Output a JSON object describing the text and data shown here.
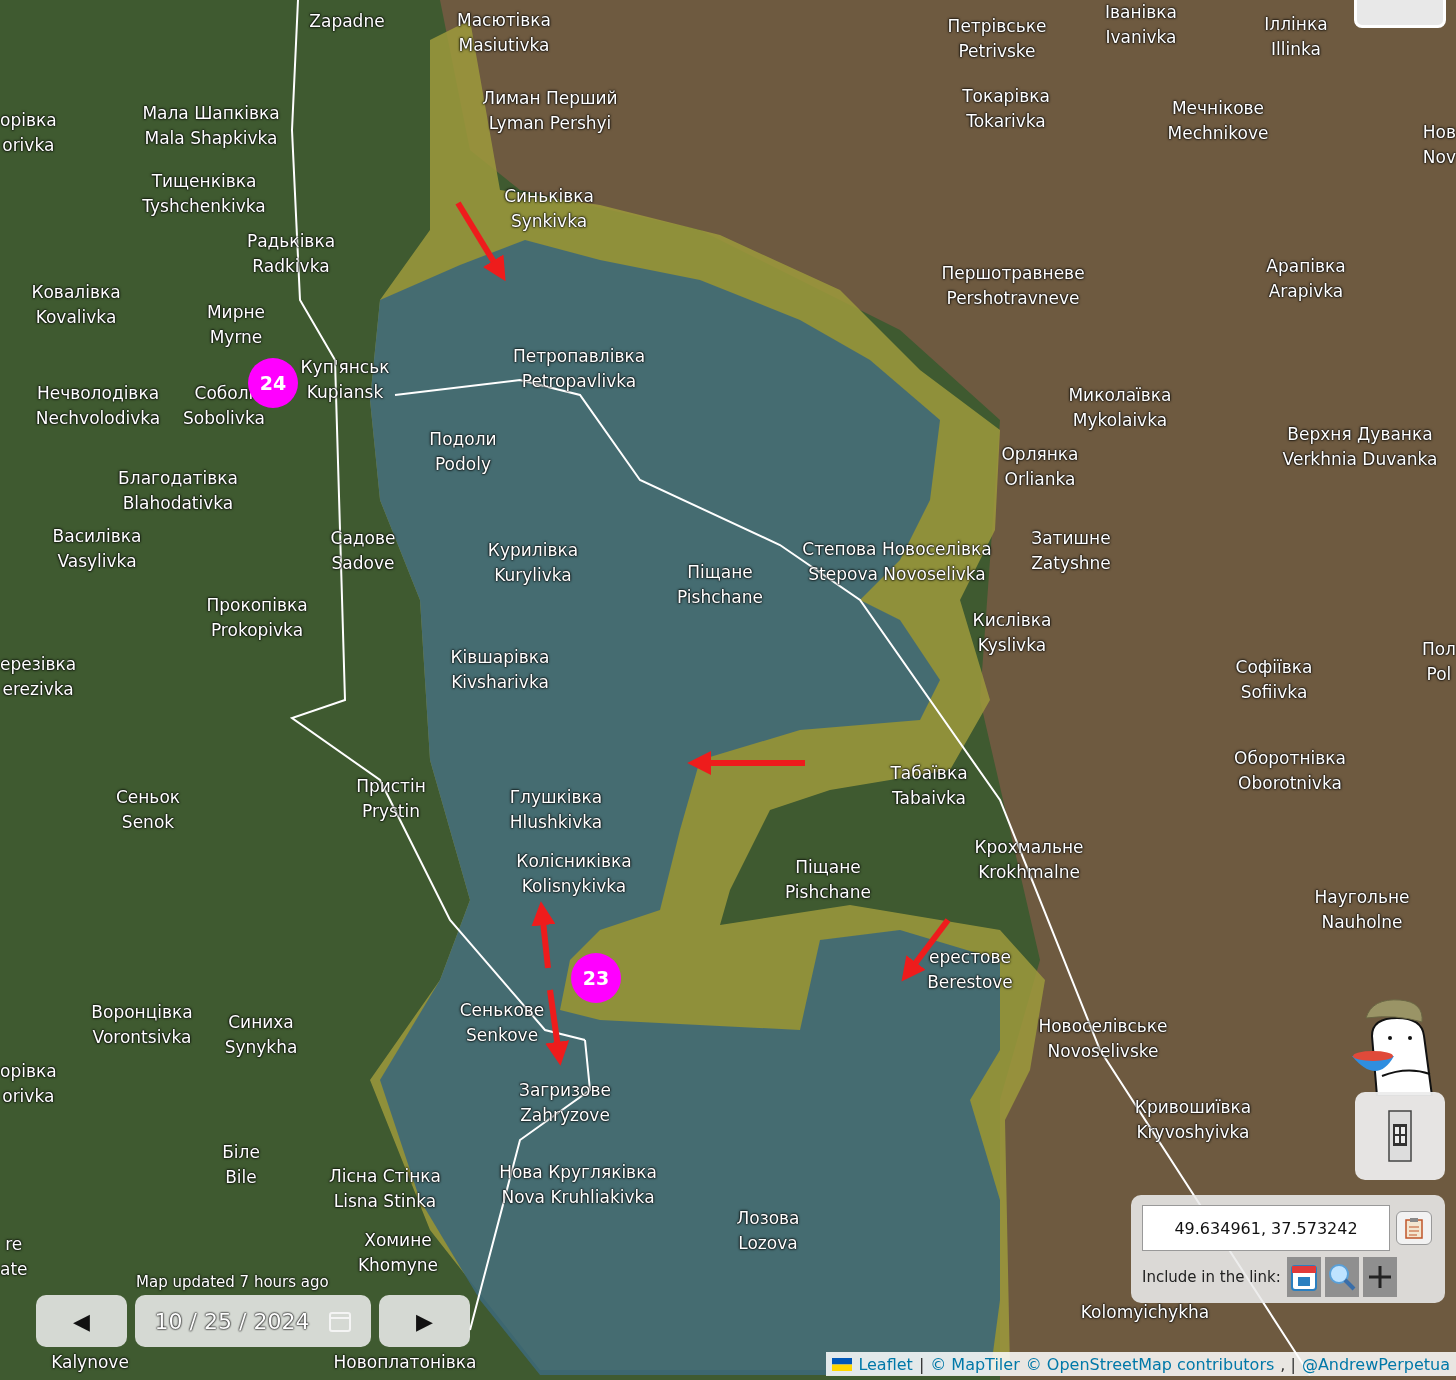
{
  "map": {
    "places": [
      {
        "lines": [
          "Zapadne"
        ]
      },
      {
        "lines": [
          "Масютівка",
          "Masiutivka"
        ]
      },
      {
        "lines": [
          "Лиман Перший",
          "Lyman Pershyi"
        ]
      },
      {
        "lines": [
          "Синьківка",
          "Synkivka"
        ]
      },
      {
        "lines": [
          "Петрівське",
          "Petrivske"
        ]
      },
      {
        "lines": [
          "Іванівка",
          "Ivanivka"
        ]
      },
      {
        "lines": [
          "Іллінка",
          "Illinka"
        ]
      },
      {
        "lines": [
          "Токарівка",
          "Tokarivka"
        ]
      },
      {
        "lines": [
          "Мечнікове",
          "Mechnikove"
        ]
      },
      {
        "lines": [
          "Нов",
          "Nov"
        ]
      },
      {
        "lines": [
          "орівка",
          "orivka"
        ]
      },
      {
        "lines": [
          "Мала Шапківка",
          "Mala Shapkivka"
        ]
      },
      {
        "lines": [
          "Тищенківка",
          "Tyshchenkivka"
        ]
      },
      {
        "lines": [
          "Радьківка",
          "Radkivka"
        ]
      },
      {
        "lines": [
          "Ковалівка",
          "Kovalivka"
        ]
      },
      {
        "lines": [
          "Мирне",
          "Myrne"
        ]
      },
      {
        "lines": [
          "Першотравневе",
          "Pershotravneve"
        ]
      },
      {
        "lines": [
          "Арапівка",
          "Arapivka"
        ]
      },
      {
        "lines": [
          "Куп'янськ",
          "Kupiansk"
        ]
      },
      {
        "lines": [
          "Нечволодівка",
          "Nechvolodivka"
        ]
      },
      {
        "lines": [
          "Соболі",
          "Sobolivka"
        ]
      },
      {
        "lines": [
          "Петропавлівка",
          "Petropavlivka"
        ]
      },
      {
        "lines": [
          "Миколаївка",
          "Mykolaivka"
        ]
      },
      {
        "lines": [
          "Подоли",
          "Podoly"
        ]
      },
      {
        "lines": [
          "Верхня Дуванка",
          "Verkhnia Duvanka"
        ]
      },
      {
        "lines": [
          "Орлянка",
          "Orlianka"
        ]
      },
      {
        "lines": [
          "Благодатівка",
          "Blahodativka"
        ]
      },
      {
        "lines": [
          "Василівка",
          "Vasylivka"
        ]
      },
      {
        "lines": [
          "Садове",
          "Sadove"
        ]
      },
      {
        "lines": [
          "Курилівка",
          "Kurylivka"
        ]
      },
      {
        "lines": [
          "Піщане",
          "Pishchane"
        ]
      },
      {
        "lines": [
          "Степова Новоселівка",
          "Stepova Novoselivka"
        ]
      },
      {
        "lines": [
          "Затишне",
          "Zatyshne"
        ]
      },
      {
        "lines": [
          "Прокопівка",
          "Prokopivka"
        ]
      },
      {
        "lines": [
          "Кислівка",
          "Kyslivka"
        ]
      },
      {
        "lines": [
          "ерезівка",
          "erezivka"
        ]
      },
      {
        "lines": [
          "Ківшарівка",
          "Kivsharivka"
        ]
      },
      {
        "lines": [
          "Софіївка",
          "Sofiivka"
        ]
      },
      {
        "lines": [
          "Пол",
          "Pol"
        ]
      },
      {
        "lines": [
          "Оборотнівка",
          "Oborotnivka"
        ]
      },
      {
        "lines": [
          "Табаївка",
          "Tabaivka"
        ]
      },
      {
        "lines": [
          "Сеньок",
          "Senok"
        ]
      },
      {
        "lines": [
          "Пристін",
          "Prystin"
        ]
      },
      {
        "lines": [
          "Глушківка",
          "Hlushkivka"
        ]
      },
      {
        "lines": [
          "Крохмальне",
          "Krokhmalne"
        ]
      },
      {
        "lines": [
          "Колісниківка",
          "Kolisnykivka"
        ]
      },
      {
        "lines": [
          "Піщане",
          "Pishchane"
        ]
      },
      {
        "lines": [
          "Наугольне",
          "Nauholne"
        ]
      },
      {
        "lines": [
          "ерестове",
          "Berestove"
        ]
      },
      {
        "lines": [
          "Воронцівка",
          "Vorontsivka"
        ]
      },
      {
        "lines": [
          "Синиха",
          "Synykha"
        ]
      },
      {
        "lines": [
          "Сеньковe",
          "Senkove"
        ]
      },
      {
        "lines": [
          "Новоселівське",
          "Novoselivske"
        ]
      },
      {
        "lines": [
          "орівка",
          "orivka"
        ]
      },
      {
        "lines": [
          "Загризове",
          "Zahryzove"
        ]
      },
      {
        "lines": [
          "Кривошиївка",
          "Kryvoshyivka"
        ]
      },
      {
        "lines": [
          "Біле",
          "Bile"
        ]
      },
      {
        "lines": [
          "Лісна Стінка",
          "Lisna Stinka"
        ]
      },
      {
        "lines": [
          "Нова Кругляківка",
          "Nova Kruhliakivka"
        ]
      },
      {
        "lines": [
          "Лозова",
          "Lozova"
        ]
      },
      {
        "lines": [
          "re",
          "ate"
        ]
      },
      {
        "lines": [
          "Хомине",
          "Khomyne"
        ]
      },
      {
        "lines": [
          "Kolomyichykha"
        ]
      },
      {
        "lines": [
          "Kalynove"
        ]
      },
      {
        "lines": [
          "Новоплатонівка"
        ]
      }
    ],
    "markers": [
      {
        "label": "24"
      },
      {
        "label": "23"
      }
    ]
  },
  "date_nav": {
    "status": "Map updated 7 hours ago",
    "prev": "◀",
    "date": "10 / 25 / 2024",
    "next": "▶"
  },
  "link_panel": {
    "coordinates": "49.634961, 37.573242",
    "include_label": "Include in the link:"
  },
  "attribution": [
    {
      "kind": "link",
      "text": "Leaflet"
    },
    {
      "kind": "text",
      "text": "|"
    },
    {
      "kind": "link",
      "text": "© MapTiler"
    },
    {
      "kind": "link",
      "text": "© OpenStreetMap contributors"
    },
    {
      "kind": "text",
      "text": ", |"
    },
    {
      "kind": "link",
      "text": "@AndrewPerpetua"
    }
  ]
}
